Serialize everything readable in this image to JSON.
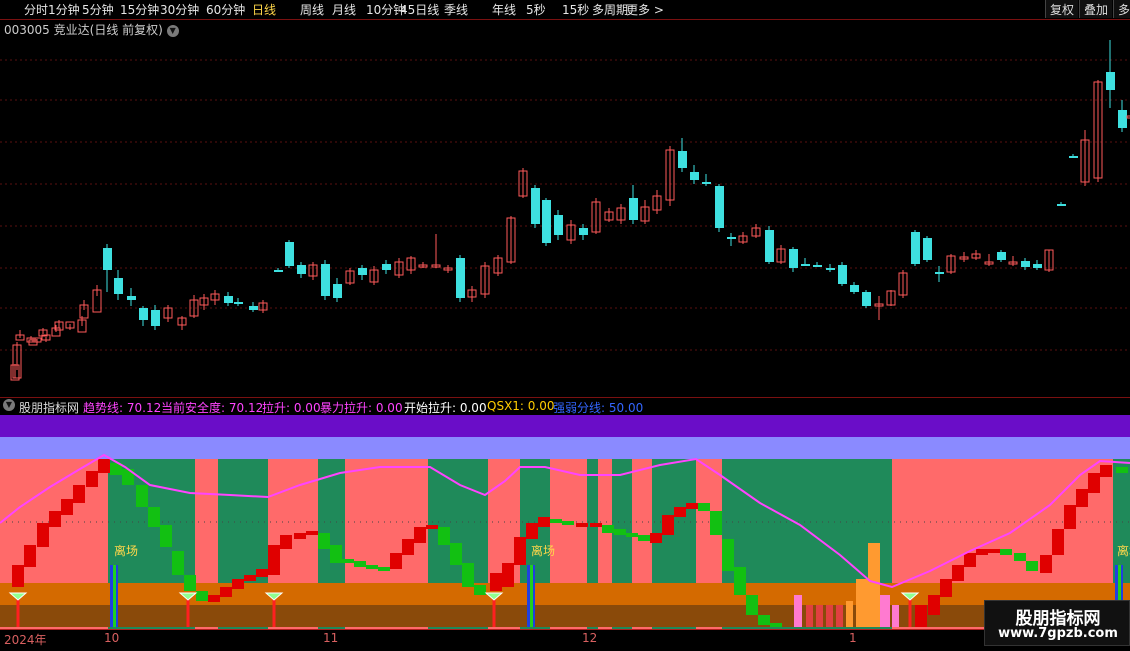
{
  "toolbar": {
    "periods": [
      "分时",
      "1分钟",
      "5分钟",
      "15分钟",
      "30分钟",
      "60分钟",
      "日线",
      "周线",
      "月线",
      "10分钟",
      "45日线",
      "季线",
      "年线",
      "5秒",
      "15秒",
      "多周期",
      "更多 >"
    ],
    "active": "日线",
    "buttons": [
      "复权",
      "叠加",
      "多"
    ]
  },
  "stock": {
    "code": "003005",
    "name": "竞业达",
    "period_label": "(日线 前复权)"
  },
  "indicator": {
    "name": "股朋指标网",
    "params": [
      {
        "label": "趋势线: 70.12",
        "color": "#ff44ff"
      },
      {
        "label": "当前安全度: 70.12",
        "color": "#ff44ff"
      },
      {
        "label": "拉升: 0.00",
        "color": "#ff44ff"
      },
      {
        "label": "暴力拉升: 0.00",
        "color": "#ff44ff"
      },
      {
        "label": "开始拉升: 0.00",
        "color": "#ffffff"
      },
      {
        "label": "QSX1: 0.00",
        "color": "#ffcc00"
      },
      {
        "label": "强弱分线: 50.00",
        "color": "#3366ff"
      }
    ],
    "signal_label": "离场",
    "colors": {
      "bull": "#ff6a6a",
      "bear": "#1f8a5a",
      "trend": "#ff44ff",
      "top": "#6a0dc8",
      "band": "#8a8aff",
      "orange": "#d46a00",
      "brown": "#8a4a0a"
    }
  },
  "date_axis": [
    "2024年",
    "10",
    "11",
    "12",
    "1"
  ],
  "watermark": {
    "title": "股朋指标网",
    "url": "www.7gpzb.com"
  },
  "candles": [
    [
      11,
      380,
      365,
      378,
      364
    ],
    [
      13,
      378,
      345,
      370,
      342
    ],
    [
      16,
      340,
      335,
      338,
      330
    ],
    [
      27,
      342,
      338,
      340,
      336
    ],
    [
      29,
      345,
      340,
      342,
      338
    ],
    [
      33,
      342,
      338,
      341,
      339
    ],
    [
      39,
      336,
      330,
      334,
      328
    ],
    [
      42,
      340,
      335,
      342,
      337
    ],
    [
      52,
      336,
      328,
      332,
      325
    ],
    [
      55,
      330,
      322,
      328,
      320
    ],
    [
      66,
      328,
      322,
      330,
      324
    ],
    [
      78,
      332,
      320,
      326,
      316
    ],
    [
      80,
      318,
      305,
      310,
      300
    ],
    [
      93,
      312,
      290,
      296,
      285
    ],
    [
      103,
      248,
      270,
      292,
      244
    ],
    [
      114,
      278,
      294,
      300,
      270
    ],
    [
      127,
      296,
      300,
      306,
      288
    ],
    [
      139,
      308,
      320,
      326,
      306
    ],
    [
      151,
      310,
      326,
      330,
      305
    ],
    [
      164,
      318,
      308,
      322,
      305
    ],
    [
      178,
      325,
      318,
      330,
      316
    ],
    [
      190,
      316,
      300,
      318,
      295
    ],
    [
      200,
      305,
      298,
      310,
      294
    ],
    [
      211,
      300,
      294,
      305,
      290
    ],
    [
      224,
      296,
      303,
      306,
      292
    ],
    [
      234,
      302,
      304,
      306,
      298
    ],
    [
      249,
      306,
      310,
      312,
      302
    ],
    [
      259,
      310,
      303,
      313,
      300
    ],
    [
      274,
      270,
      270,
      272,
      268
    ],
    [
      285,
      242,
      266,
      268,
      240
    ],
    [
      297,
      265,
      274,
      278,
      262
    ],
    [
      309,
      276,
      265,
      280,
      262
    ],
    [
      321,
      264,
      296,
      300,
      260
    ],
    [
      333,
      284,
      298,
      302,
      278
    ],
    [
      346,
      283,
      271,
      285,
      268
    ],
    [
      358,
      268,
      275,
      280,
      265
    ],
    [
      370,
      282,
      270,
      285,
      266
    ],
    [
      382,
      264,
      270,
      274,
      260
    ],
    [
      395,
      275,
      262,
      278,
      258
    ],
    [
      407,
      270,
      258,
      274,
      256
    ],
    [
      419,
      266,
      265,
      268,
      262
    ],
    [
      432,
      266,
      265,
      268,
      234
    ],
    [
      444,
      270,
      268,
      273,
      265
    ],
    [
      456,
      258,
      298,
      302,
      255
    ],
    [
      468,
      297,
      290,
      302,
      286
    ],
    [
      481,
      294,
      266,
      298,
      262
    ],
    [
      494,
      273,
      258,
      276,
      255
    ],
    [
      507,
      262,
      218,
      264,
      216
    ],
    [
      519,
      196,
      171,
      198,
      168
    ],
    [
      531,
      188,
      224,
      228,
      185
    ],
    [
      542,
      200,
      243,
      246,
      198
    ],
    [
      554,
      215,
      235,
      240,
      210
    ],
    [
      567,
      240,
      225,
      244,
      220
    ],
    [
      579,
      228,
      235,
      240,
      224
    ],
    [
      592,
      232,
      202,
      234,
      198
    ],
    [
      605,
      220,
      212,
      222,
      208
    ],
    [
      617,
      220,
      208,
      224,
      204
    ],
    [
      629,
      198,
      220,
      224,
      185
    ],
    [
      641,
      221,
      207,
      224,
      200
    ],
    [
      653,
      210,
      196,
      214,
      190
    ],
    [
      666,
      200,
      150,
      206,
      146
    ],
    [
      678,
      151,
      168,
      172,
      138
    ],
    [
      690,
      172,
      180,
      184,
      165
    ],
    [
      702,
      182,
      184,
      186,
      174
    ],
    [
      715,
      186,
      228,
      232,
      184
    ],
    [
      727,
      237,
      238,
      246,
      233
    ],
    [
      739,
      242,
      236,
      244,
      232
    ],
    [
      752,
      236,
      228,
      238,
      224
    ],
    [
      765,
      230,
      262,
      264,
      226
    ],
    [
      777,
      262,
      249,
      264,
      245
    ],
    [
      789,
      249,
      268,
      272,
      247
    ],
    [
      801,
      264,
      264,
      266,
      258
    ],
    [
      813,
      265,
      265,
      267,
      262
    ],
    [
      826,
      268,
      270,
      272,
      264
    ],
    [
      838,
      265,
      284,
      286,
      262
    ],
    [
      850,
      285,
      292,
      294,
      282
    ],
    [
      862,
      292,
      306,
      308,
      290
    ],
    [
      875,
      305,
      304,
      320,
      296
    ],
    [
      887,
      305,
      291,
      306,
      290
    ],
    [
      899,
      295,
      273,
      298,
      270
    ],
    [
      911,
      232,
      264,
      266,
      230
    ],
    [
      923,
      238,
      260,
      262,
      236
    ],
    [
      935,
      272,
      272,
      282,
      266
    ],
    [
      947,
      272,
      256,
      274,
      254
    ],
    [
      960,
      258,
      257,
      262,
      252
    ],
    [
      972,
      258,
      254,
      260,
      250
    ],
    [
      985,
      263,
      262,
      266,
      254
    ],
    [
      997,
      252,
      260,
      262,
      250
    ],
    [
      1009,
      263,
      262,
      266,
      256
    ],
    [
      1021,
      261,
      267,
      270,
      258
    ],
    [
      1033,
      264,
      268,
      270,
      260
    ],
    [
      1045,
      270,
      250,
      272,
      250
    ],
    [
      1057,
      204,
      204,
      206,
      202
    ],
    [
      1069,
      156,
      156,
      158,
      154
    ],
    [
      1081,
      182,
      140,
      186,
      130
    ],
    [
      1094,
      178,
      82,
      182,
      80
    ],
    [
      1106,
      72,
      90,
      108,
      40
    ],
    [
      1118,
      110,
      128,
      132,
      100
    ],
    [
      1127,
      118,
      116,
      120,
      110
    ]
  ]
}
